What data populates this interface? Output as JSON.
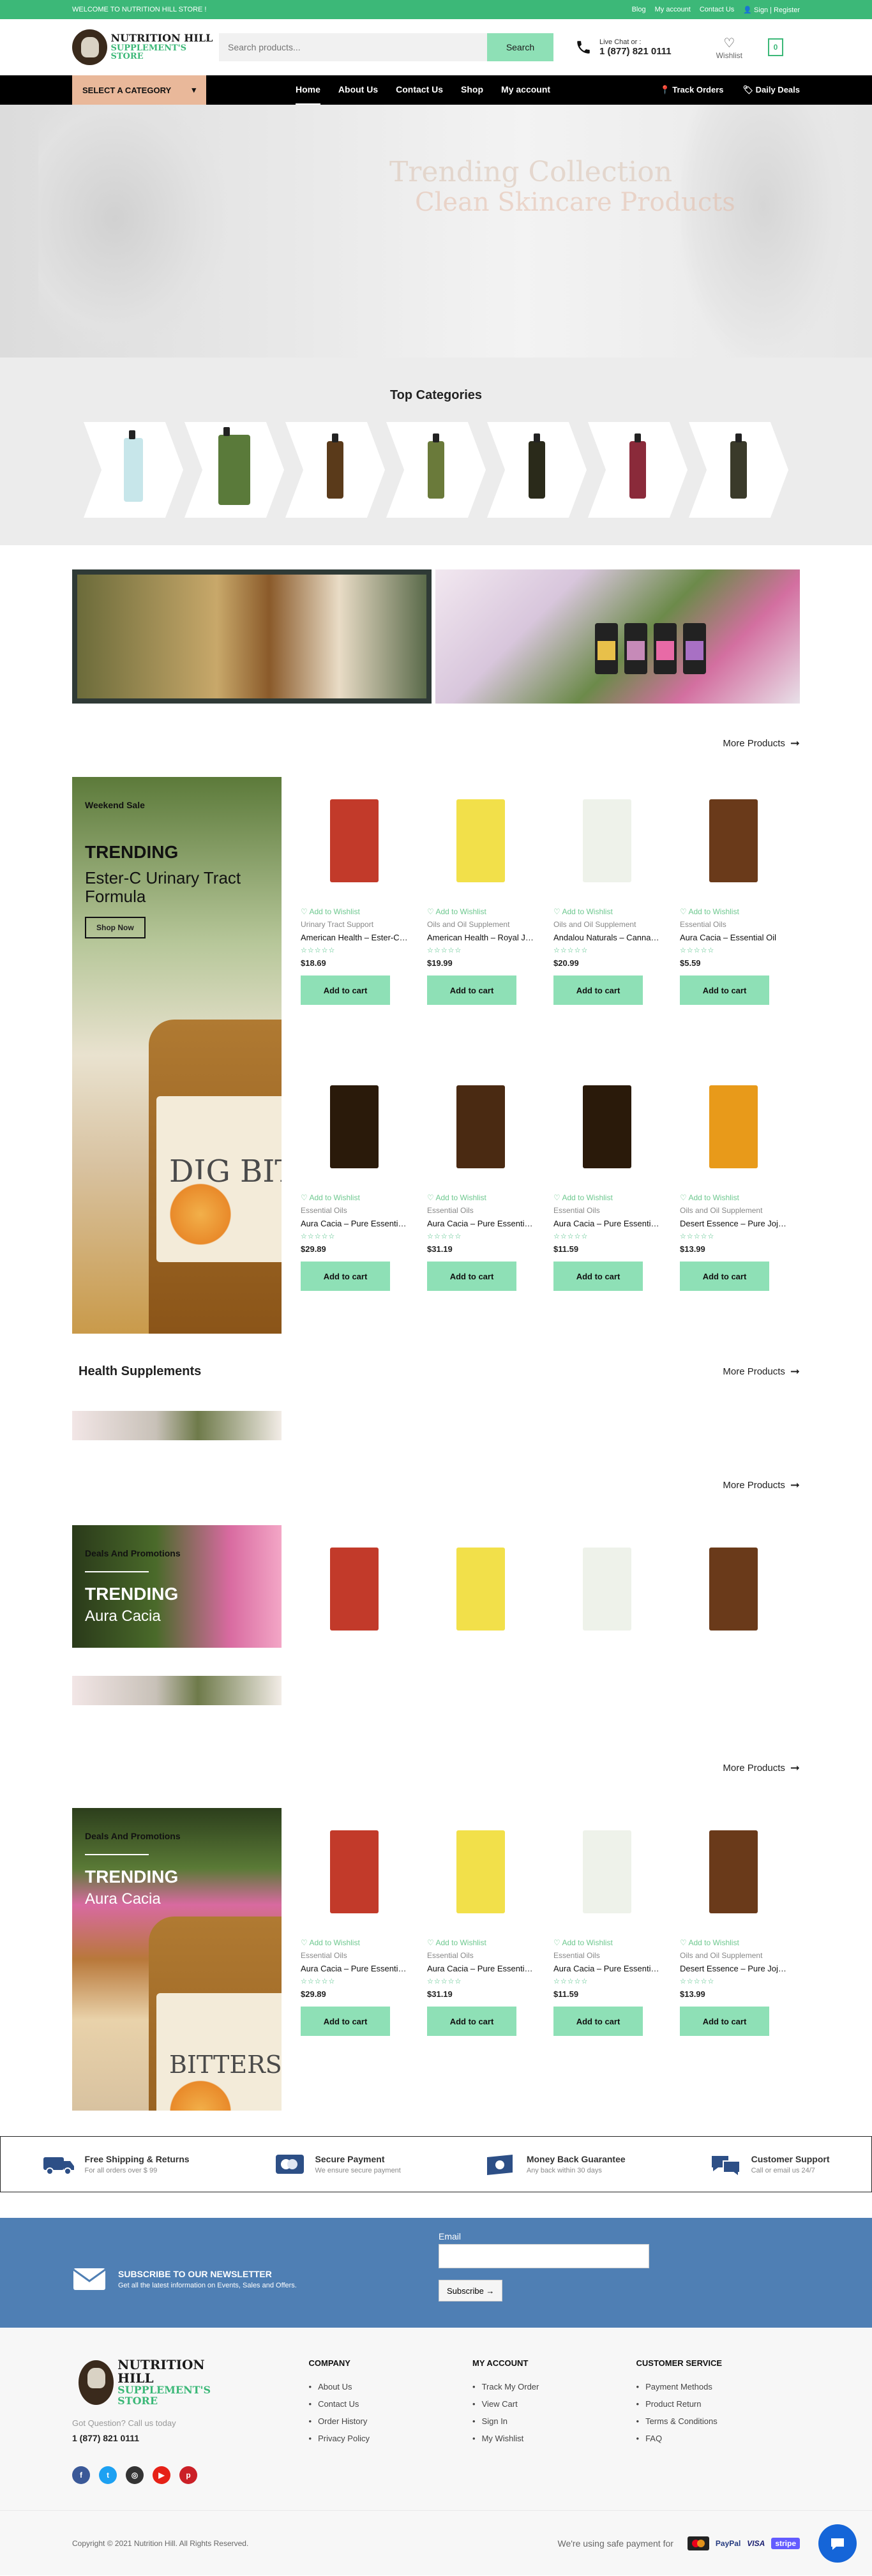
{
  "topbar": {
    "welcome": "WELCOME TO NUTRITION HILL STORE !",
    "links": [
      "Blog",
      "My account",
      "Contact Us"
    ],
    "signin": "Sign | Register"
  },
  "header": {
    "logo_line1": "NUTRITION HILL",
    "logo_line2": "SUPPLEMENT'S STORE",
    "search_placeholder": "Search products...",
    "search_button": "Search",
    "live_chat_label": "Live Chat or :",
    "phone": "1 (877) 821 0111",
    "wishlist_label": "Wishlist",
    "cart_count": "0"
  },
  "nav": {
    "category_button": "SELECT A CATEGORY",
    "menu": [
      "Home",
      "About Us",
      "Contact Us",
      "Shop",
      "My account"
    ],
    "track_orders": "Track Orders",
    "daily_deals": "Daily Deals"
  },
  "hero": {
    "line1": "Trending Collection",
    "line2": "Clean Skincare Products"
  },
  "categories": {
    "title": "Top Categories",
    "bottle_colors": [
      "#c7e6ea",
      "#5a7a3a",
      "#5a3a1a",
      "#6a7a3a",
      "#2a2a1a",
      "#8a2a3a",
      "#3a3a2a"
    ]
  },
  "more_products": "More Products",
  "section1": {
    "promo_kicker": "Weekend Sale",
    "promo_trending": "TRENDING",
    "promo_subtitle": "Ester-C Urinary Tract Formula",
    "promo_button": "Shop Now",
    "jar_label": "DIG BIT",
    "products": [
      {
        "category": "Urinary Tract Support",
        "title": "American Health – Ester-C Urinary Tract Formula",
        "price": "$18.69",
        "color": "#c23a2a"
      },
      {
        "category": "Oils and Oil Supplement",
        "title": "American Health – Royal Jelly Evening Primrose Oil",
        "price": "$19.99",
        "color": "#f2e04a"
      },
      {
        "category": "Oils and Oil Supplement",
        "title": "Andalou Naturals – Cannabis Hemp Seed",
        "price": "$20.99",
        "color": "#eef2ea"
      },
      {
        "category": "Essential Oils",
        "title": "Aura Cacia – Essential Oil",
        "price": "$5.59",
        "color": "#6a3a1a"
      },
      {
        "category": "Essential Oils",
        "title": "Aura Cacia – Pure Essential Oil",
        "price": "$29.89",
        "color": "#2a1a0a"
      },
      {
        "category": "Essential Oils",
        "title": "Aura Cacia – Pure Essential Oil",
        "price": "$31.19",
        "color": "#4a2a12"
      },
      {
        "category": "Essential Oils",
        "title": "Aura Cacia – Pure Essential Oil",
        "price": "$11.59",
        "color": "#2a1a0a"
      },
      {
        "category": "Oils and Oil Supplement",
        "title": "Desert Essence – Pure Jojoba Oil",
        "price": "$13.99",
        "color": "#e89a1a"
      }
    ],
    "wishlist_label": "Add to Wishlist",
    "add_to_cart": "Add to cart",
    "stars": "☆☆☆☆☆"
  },
  "section2": {
    "title": "Health Supplements"
  },
  "section3": {
    "promo_kicker": "Deals And Promotions",
    "promo_trending": "TRENDING",
    "promo_subtitle": "Aura Cacia",
    "product_colors": [
      "#c23a2a",
      "#f2e04a",
      "#eef2ea",
      "#6a3a1a"
    ]
  },
  "section4": {
    "promo_kicker": "Deals And Promotions",
    "promo_trending": "TRENDING",
    "promo_subtitle": "Aura Cacia",
    "jar_label": "BITTERS",
    "products": [
      {
        "category": "Essential Oils",
        "title": "Aura Cacia – Pure Essential Oil",
        "price": "$29.89",
        "color": "#c23a2a"
      },
      {
        "category": "Essential Oils",
        "title": "Aura Cacia – Pure Essential Oil",
        "price": "$31.19",
        "color": "#f2e04a"
      },
      {
        "category": "Essential Oils",
        "title": "Aura Cacia – Pure Essential Oil",
        "price": "$11.59",
        "color": "#eef2ea"
      },
      {
        "category": "Oils and Oil Supplement",
        "title": "Desert Essence – Pure Jojoba Oil",
        "price": "$13.99",
        "color": "#6a3a1a"
      }
    ]
  },
  "features": [
    {
      "title": "Free Shipping & Returns",
      "sub": "For all orders over $ 99",
      "icon": "truck-icon"
    },
    {
      "title": "Secure Payment",
      "sub": "We ensure secure payment",
      "icon": "credit-card-icon"
    },
    {
      "title": "Money Back Guarantee",
      "sub": "Any back within 30 days",
      "icon": "money-icon"
    },
    {
      "title": "Customer Support",
      "sub": "Call or email us 24/7",
      "icon": "chat-icon"
    }
  ],
  "newsletter": {
    "title": "SUBSCRIBE TO OUR NEWSLETTER",
    "subtitle": "Get all the latest information on Events, Sales and Offers.",
    "email_label": "Email",
    "subscribe": "Subscribe →"
  },
  "footer": {
    "question": "Got Question? Call us today",
    "phone": "1 (877) 821 0111",
    "company_title": "COMPANY",
    "company_links": [
      "About Us",
      "Contact Us",
      "Order History",
      "Privacy Policy"
    ],
    "account_title": "MY ACCOUNT",
    "account_links": [
      "Track My Order",
      "View Cart",
      "Sign In",
      "My Wishlist"
    ],
    "service_title": "CUSTOMER SERVICE",
    "service_links": [
      "Payment Methods",
      "Product Return",
      "Terms & Conditions",
      "FAQ"
    ],
    "copyright": "Copyright © 2021 Nutrition Hill. All Rights Reserved.",
    "safe_payment": "We're using safe payment for",
    "payment_logos": [
      "PayPal",
      "VISA",
      "stripe"
    ]
  }
}
